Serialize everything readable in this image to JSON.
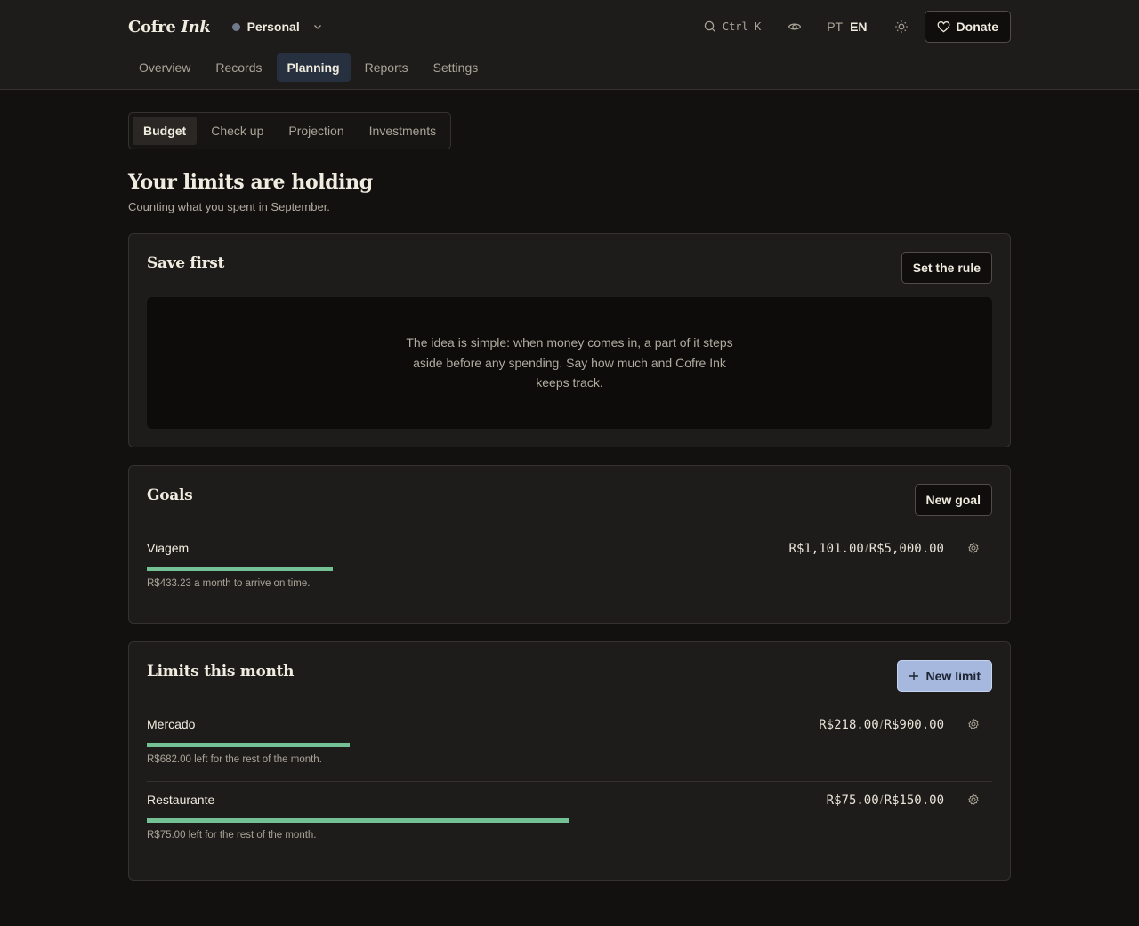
{
  "header": {
    "brand": {
      "name_plain": "Cofre",
      "name_italic": "Ink"
    },
    "workspace": {
      "label": "Personal",
      "dot_color": "#6f7a8c"
    },
    "search_shortcut": "Ctrl K",
    "languages": {
      "pt": "PT",
      "en": "EN",
      "active": "EN"
    },
    "donate_label": "Donate",
    "nav": [
      {
        "label": "Overview"
      },
      {
        "label": "Records"
      },
      {
        "label": "Planning",
        "active": true
      },
      {
        "label": "Reports"
      },
      {
        "label": "Settings"
      }
    ]
  },
  "tabs": [
    {
      "label": "Budget",
      "active": true
    },
    {
      "label": "Check up"
    },
    {
      "label": "Projection"
    },
    {
      "label": "Investments"
    }
  ],
  "page": {
    "title": "Your limits are holding",
    "subtitle": "Counting what you spent in September."
  },
  "save_first": {
    "title": "Save first",
    "button_label": "Set the rule",
    "empty_text": "The idea is simple: when money comes in, a part of it steps aside before any spending. Say how much and Cofre Ink keeps track."
  },
  "goals": {
    "title": "Goals",
    "button_label": "New goal",
    "items": [
      {
        "name": "Viagem",
        "current": "R$1,101.00",
        "target": "R$5,000.00",
        "progress": 0.22,
        "note": "R$433.23 a month to arrive on time."
      }
    ]
  },
  "limits": {
    "title": "Limits this month",
    "button_label": "New limit",
    "items": [
      {
        "name": "Mercado",
        "spent": "R$218.00",
        "limit": "R$900.00",
        "progress": 0.24,
        "note": "R$682.00 left for the rest of the month."
      },
      {
        "name": "Restaurante",
        "spent": "R$75.00",
        "limit": "R$150.00",
        "progress": 0.5,
        "note": "R$75.00 left for the rest of the month."
      }
    ]
  },
  "colors": {
    "accent": "#a7b8de",
    "progress": "#74c195",
    "background": "#121110",
    "card": "#1e1c1a"
  },
  "amount_separator": "/"
}
